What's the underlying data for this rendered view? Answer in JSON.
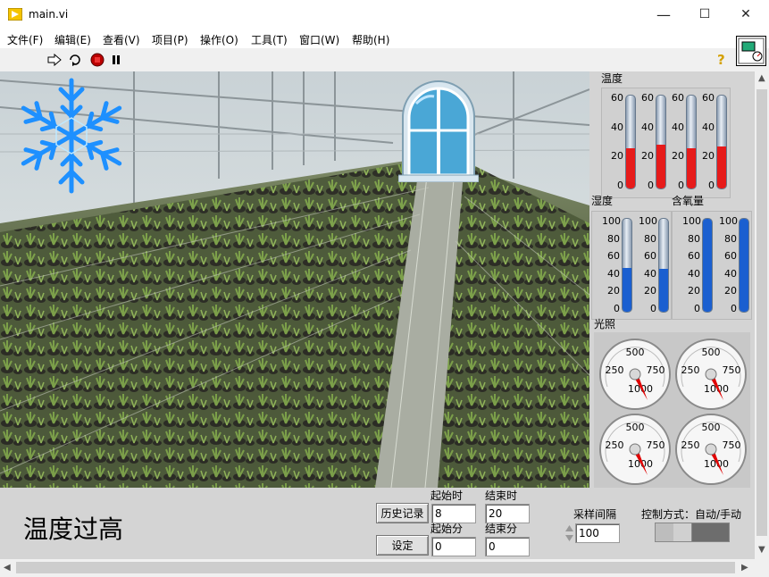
{
  "window": {
    "title": "main.vi",
    "minimize": "—",
    "maximize": "☐",
    "close": "✕"
  },
  "menu": [
    "文件(F)",
    "编辑(E)",
    "查看(V)",
    "项目(P)",
    "操作(O)",
    "工具(T)",
    "窗口(W)",
    "帮助(H)"
  ],
  "toolbar": {
    "run_icon": "run-arrow-icon",
    "run_continuous_icon": "run-continuously-icon",
    "abort_icon": "abort-icon",
    "pause_icon": "pause-icon",
    "help": "?"
  },
  "indicators": {
    "snowflake_icon": "snowflake-icon",
    "window_icon": "window-icon"
  },
  "temperature": {
    "label": "温度",
    "ticks": [
      "60",
      "40",
      "20",
      "0"
    ],
    "max": 60,
    "color": "#e61b1b",
    "values": [
      26,
      28,
      26,
      27
    ]
  },
  "humidity": {
    "label": "湿度",
    "ticks": [
      "100",
      "80",
      "60",
      "40",
      "20",
      "0"
    ],
    "max": 100,
    "color": "#1a5fd0",
    "values": [
      47,
      46
    ]
  },
  "oxygen": {
    "label": "含氧量",
    "ticks": [
      "100",
      "80",
      "60",
      "40",
      "20",
      "0"
    ],
    "max": 100,
    "color": "#1a5fd0",
    "values": [
      100,
      100
    ]
  },
  "light": {
    "label": "光照",
    "scale": [
      "500",
      "250",
      "750",
      "1000"
    ],
    "needle_color": "#e00000"
  },
  "alarm_text": "温度过高",
  "history_button": "历史记录",
  "set_button": "设定",
  "start_hour": {
    "label": "起始时",
    "value": "8"
  },
  "end_hour": {
    "label": "结束时",
    "value": "20"
  },
  "start_min": {
    "label": "起始分",
    "value": "0"
  },
  "end_min": {
    "label": "结束分",
    "value": "0"
  },
  "sample_interval": {
    "label": "采样间隔",
    "value": "100"
  },
  "control_mode": {
    "label": "控制方式：自动/手动"
  }
}
